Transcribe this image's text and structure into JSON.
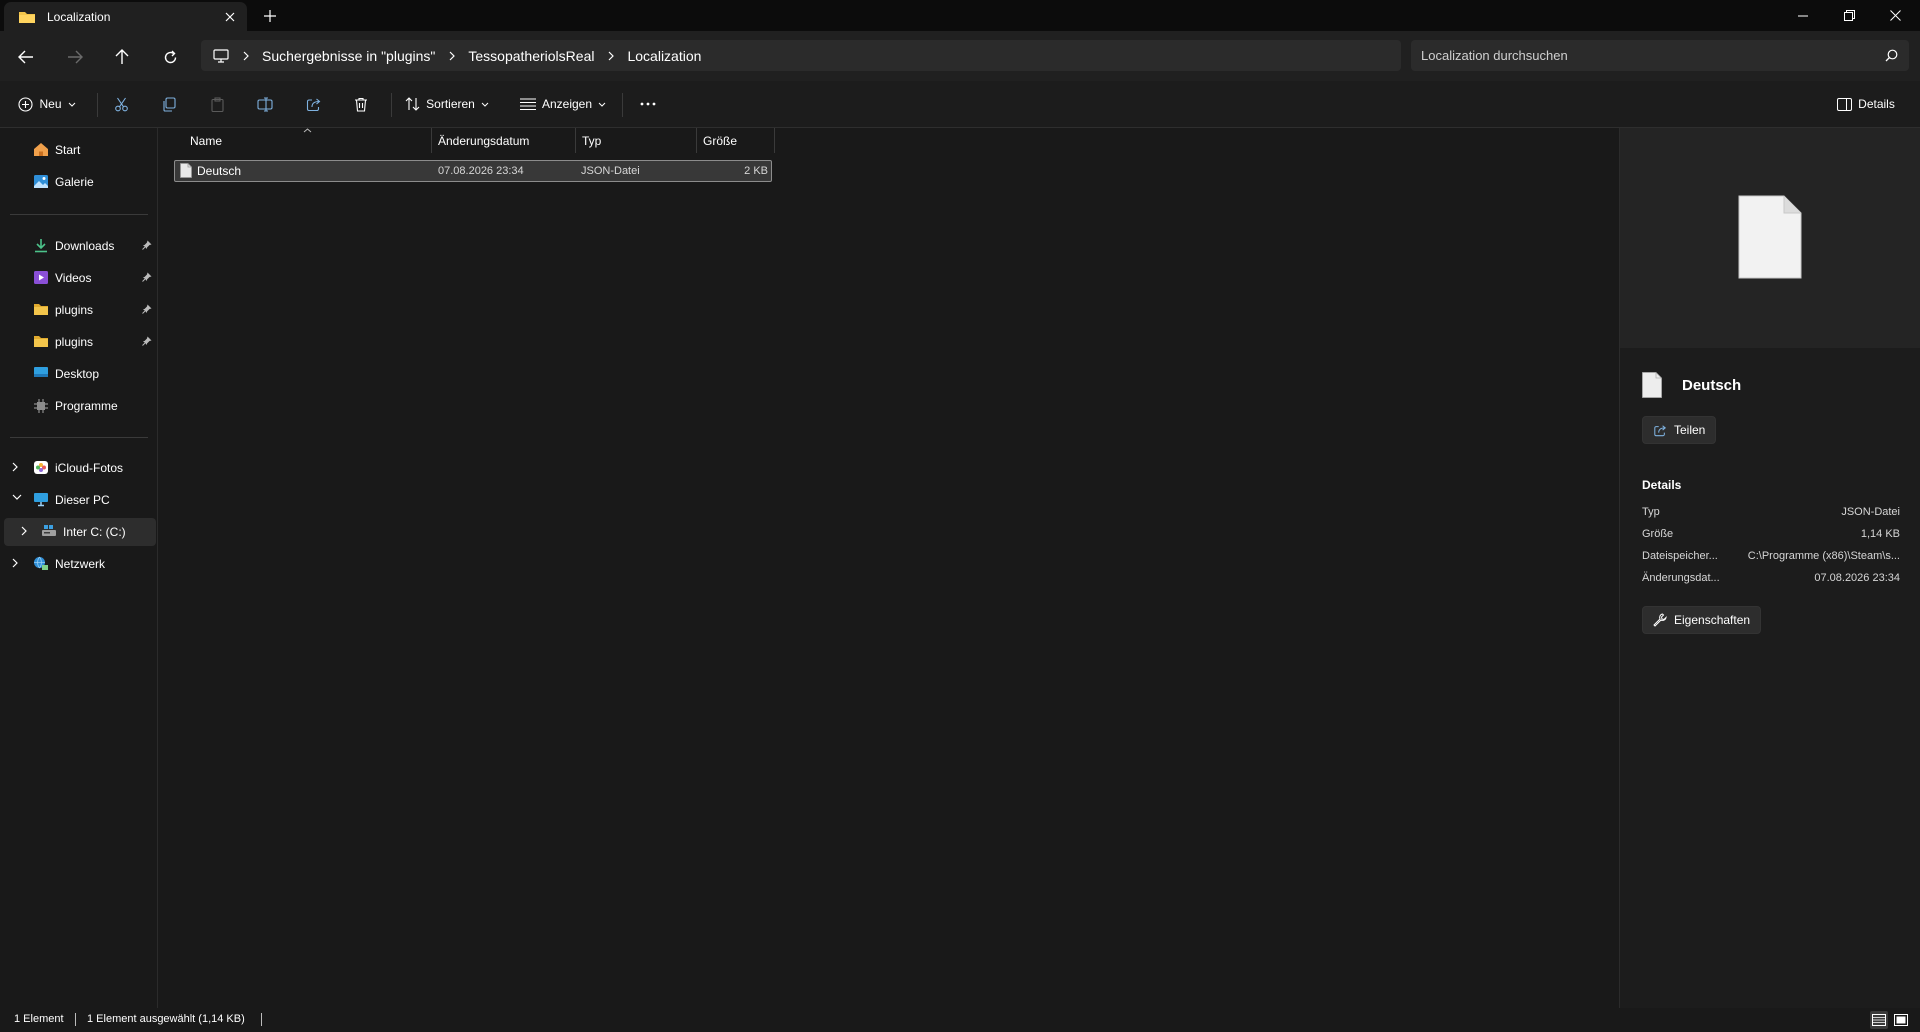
{
  "window": {
    "tab_title": "Localization"
  },
  "breadcrumb": [
    "Suchergebnisse in \"plugins\"",
    "TessopatheriolsReal",
    "Localization"
  ],
  "search": {
    "placeholder": "Localization durchsuchen"
  },
  "toolbar": {
    "new_label": "Neu",
    "sort_label": "Sortieren",
    "view_label": "Anzeigen",
    "details_label": "Details"
  },
  "sidebar": {
    "items": [
      {
        "label": "Start",
        "icon": "home-icon"
      },
      {
        "label": "Galerie",
        "icon": "gallery-icon"
      },
      {
        "label": "Downloads",
        "icon": "downloads-icon",
        "pinned": true
      },
      {
        "label": "Videos",
        "icon": "videos-icon",
        "pinned": true
      },
      {
        "label": "plugins",
        "icon": "folder-icon",
        "pinned": true
      },
      {
        "label": "plugins",
        "icon": "folder-icon",
        "pinned": true
      },
      {
        "label": "Desktop",
        "icon": "desktop-icon"
      },
      {
        "label": "Programme",
        "icon": "programs-icon"
      },
      {
        "label": "iCloud-Fotos",
        "icon": "icloud-photos-icon"
      },
      {
        "label": "Dieser PC",
        "icon": "pc-icon"
      },
      {
        "label": "Inter C: (C:)",
        "icon": "drive-icon"
      },
      {
        "label": "Netzwerk",
        "icon": "network-icon"
      }
    ]
  },
  "filelist": {
    "columns": [
      "Name",
      "Änderungsdatum",
      "Typ",
      "Größe"
    ],
    "rows": [
      {
        "name": "Deutsch",
        "modified": "07.08.2026 23:34",
        "type": "JSON-Datei",
        "size": "2 KB"
      }
    ]
  },
  "details": {
    "title": "Deutsch",
    "share_label": "Teilen",
    "section_title": "Details",
    "props": [
      {
        "key": "Typ",
        "value": "JSON-Datei"
      },
      {
        "key": "Größe",
        "value": "1,14 KB"
      },
      {
        "key": "Dateispeicher...",
        "value": "C:\\Programme (x86)\\Steam\\s..."
      },
      {
        "key": "Änderungsdat...",
        "value": "07.08.2026 23:34"
      }
    ],
    "properties_label": "Eigenschaften"
  },
  "status": {
    "count": "1 Element",
    "selection": "1 Element ausgewählt (1,14 KB)"
  },
  "colors": {
    "folder": "#f3c54b",
    "accent": "#4cc2ff"
  }
}
